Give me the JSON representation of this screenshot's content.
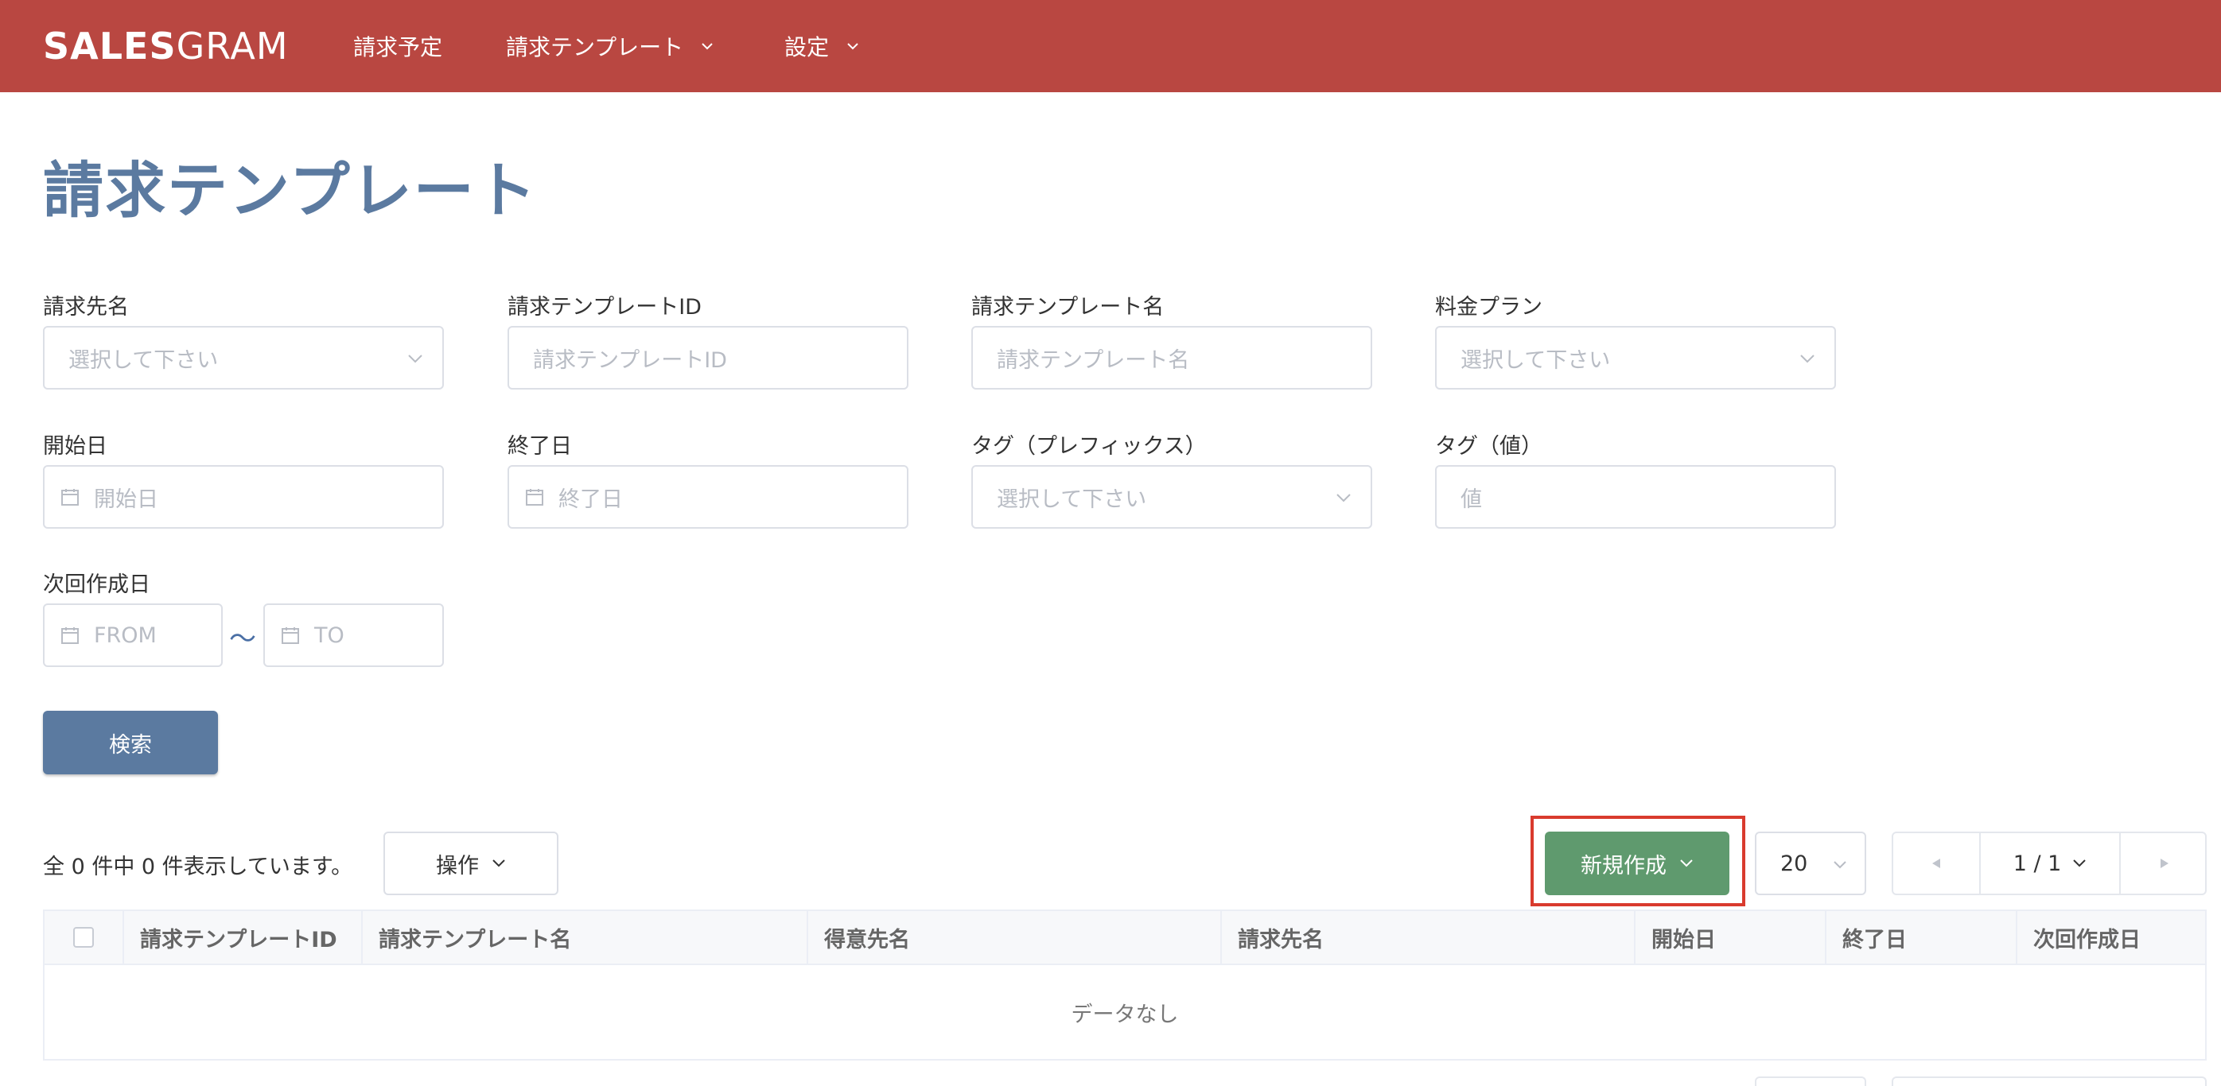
{
  "header": {
    "logo_bold": "SALES",
    "logo_light": "GRAM",
    "nav": [
      {
        "label": "請求予定"
      },
      {
        "label": "請求テンプレート"
      },
      {
        "label": "設定"
      }
    ],
    "colors": {
      "bar": "#b94741"
    }
  },
  "page": {
    "title": "請求テンプレート"
  },
  "filters": {
    "billing_to": {
      "label": "請求先名",
      "placeholder": "選択して下さい"
    },
    "template_id": {
      "label": "請求テンプレートID",
      "placeholder": "請求テンプレートID"
    },
    "template_name": {
      "label": "請求テンプレート名",
      "placeholder": "請求テンプレート名"
    },
    "plan": {
      "label": "料金プラン",
      "placeholder": "選択して下さい"
    },
    "start_date": {
      "label": "開始日",
      "placeholder": "開始日"
    },
    "end_date": {
      "label": "終了日",
      "placeholder": "終了日"
    },
    "tag_prefix": {
      "label": "タグ（プレフィックス）",
      "placeholder": "選択して下さい"
    },
    "tag_value": {
      "label": "タグ（値）",
      "placeholder": "値"
    },
    "next_date": {
      "label": "次回作成日",
      "from_placeholder": "FROM",
      "to_placeholder": "TO",
      "separator": "〜"
    },
    "search_label": "検索"
  },
  "toolbar": {
    "count_text": "全 0 件中 0 件表示しています。",
    "ops_label": "操作",
    "new_label": "新規作成",
    "per_page": "20",
    "page_indicator": "1 / 1"
  },
  "table": {
    "columns": [
      "請求テンプレートID",
      "請求テンプレート名",
      "得意先名",
      "請求先名",
      "開始日",
      "終了日",
      "次回作成日"
    ],
    "empty_text": "データなし"
  }
}
